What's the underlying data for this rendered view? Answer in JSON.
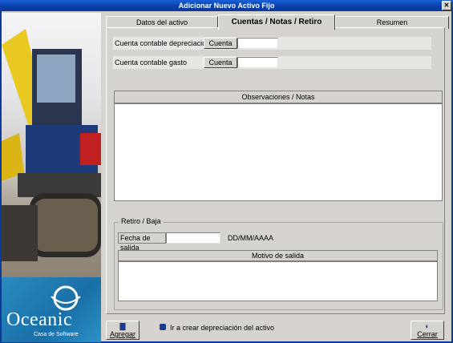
{
  "window": {
    "title": "Adicionar Nuevo Activo Fijo"
  },
  "tabs": [
    {
      "label": "Datos del activo"
    },
    {
      "label": "Cuentas / Notas / Retiro"
    },
    {
      "label": "Resumen"
    }
  ],
  "accounts": {
    "depreciation_label": "Cuenta contable depreciación",
    "depreciation_button": "Cuenta",
    "depreciation_value": "",
    "expense_label": "Cuenta contable gasto",
    "expense_button": "Cuenta",
    "expense_value": ""
  },
  "notes": {
    "header": "Observaciones / Notas",
    "value": ""
  },
  "retire": {
    "group_title": "Retiro / Baja",
    "date_label": "Fecha de salida",
    "date_value": "",
    "date_format": "DD/MM/AAAA",
    "reason_header": "Motivo de salida",
    "reason_value": ""
  },
  "footer": {
    "add_button": "Agregar",
    "go_depreciation": "Ir a crear depreciación del activo",
    "close_button": "Cerrar"
  },
  "branding": {
    "logo": "Oceanic",
    "tagline": "Casa de Software"
  },
  "colors": {
    "titlebar": "#0a3ea8",
    "face": "#d6d3ce",
    "logo_bg": "#1a6fa8"
  }
}
